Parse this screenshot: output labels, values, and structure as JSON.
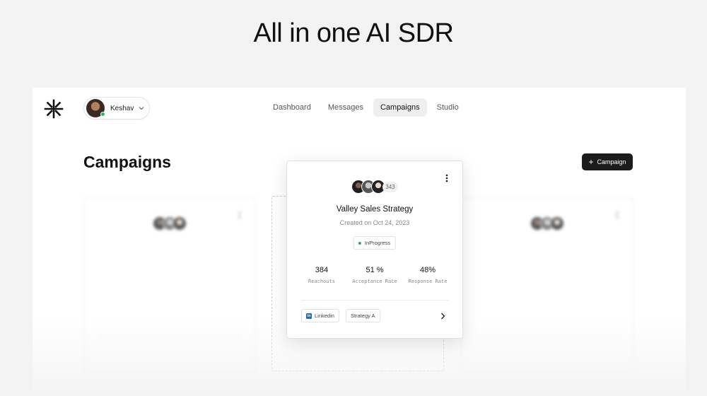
{
  "hero": {
    "title": "All in one AI SDR"
  },
  "user": {
    "name": "Keshav"
  },
  "nav": {
    "tabs": [
      "Dashboard",
      "Messages",
      "Campaigns",
      "Studio"
    ],
    "active": "Campaigns"
  },
  "page": {
    "title": "Campaigns",
    "new_button_label": "Campaign"
  },
  "cards": [
    {
      "avatar_count": "343",
      "title": "Valley Sales Strategy",
      "created": "Created on Oct 24, 2023",
      "status": "InProgress",
      "stats": [
        {
          "value": "384",
          "label": "Reachouts"
        },
        {
          "value": "51 %",
          "label": "Acceptance Rate"
        },
        {
          "value": "48%",
          "label": "Response Rate"
        }
      ],
      "tags": {
        "channel": "Linkedin",
        "strategy": "Strategy A"
      }
    }
  ],
  "colors": {
    "accent": "#1c1c1c",
    "status_dot": "#3aa36a",
    "linkedin": "#2867b2"
  },
  "icons": [
    "asterisk-logo-icon",
    "chevron-down-icon",
    "plus-icon",
    "more-vertical-icon",
    "linkedin-icon",
    "chevron-right-icon"
  ]
}
